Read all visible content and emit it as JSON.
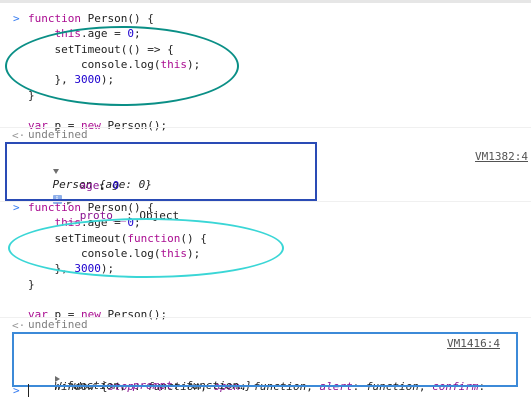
{
  "block1": {
    "code": [
      [
        {
          "t": "function",
          "c": "kw"
        },
        {
          "t": " Person() {",
          "c": "plain"
        }
      ],
      [
        {
          "t": "    this",
          "c": "kw"
        },
        {
          "t": ".age = ",
          "c": "plain"
        },
        {
          "t": "0",
          "c": "num"
        },
        {
          "t": ";",
          "c": "plain"
        }
      ],
      [
        {
          "t": "    setTimeout(() => {",
          "c": "plain"
        }
      ],
      [
        {
          "t": "        console.log(",
          "c": "plain"
        },
        {
          "t": "this",
          "c": "kw"
        },
        {
          "t": ");",
          "c": "plain"
        }
      ],
      [
        {
          "t": "    }, ",
          "c": "plain"
        },
        {
          "t": "3000",
          "c": "num"
        },
        {
          "t": ");",
          "c": "plain"
        }
      ],
      [
        {
          "t": "}",
          "c": "plain"
        }
      ],
      [
        {
          "t": "",
          "c": "plain"
        }
      ],
      [
        {
          "t": "var",
          "c": "kw"
        },
        {
          "t": " p = ",
          "c": "plain"
        },
        {
          "t": "new",
          "c": "kw"
        },
        {
          "t": " Person();",
          "c": "plain"
        }
      ]
    ],
    "result": "undefined"
  },
  "output1": {
    "object_name": "Person",
    "object_preview": " {age: 0}",
    "info": "i",
    "prop_key": "age",
    "prop_val": "0",
    "proto_key": "__proto__",
    "proto_val": ": Object",
    "source": "VM1382:4"
  },
  "block2": {
    "code": [
      [
        {
          "t": "function",
          "c": "kw"
        },
        {
          "t": " Person() {",
          "c": "plain"
        }
      ],
      [
        {
          "t": "    this",
          "c": "kw"
        },
        {
          "t": ".age = ",
          "c": "plain"
        },
        {
          "t": "0",
          "c": "num"
        },
        {
          "t": ";",
          "c": "plain"
        }
      ],
      [
        {
          "t": "    setTimeout(",
          "c": "plain"
        },
        {
          "t": "function",
          "c": "kw"
        },
        {
          "t": "() {",
          "c": "plain"
        }
      ],
      [
        {
          "t": "        console.log(",
          "c": "plain"
        },
        {
          "t": "this",
          "c": "kw"
        },
        {
          "t": ");",
          "c": "plain"
        }
      ],
      [
        {
          "t": "    }, ",
          "c": "plain"
        },
        {
          "t": "3000",
          "c": "num"
        },
        {
          "t": ");",
          "c": "plain"
        }
      ],
      [
        {
          "t": "}",
          "c": "plain"
        }
      ],
      [
        {
          "t": "",
          "c": "plain"
        }
      ],
      [
        {
          "t": "var",
          "c": "kw"
        },
        {
          "t": " p = ",
          "c": "plain"
        },
        {
          "t": "new",
          "c": "kw"
        },
        {
          "t": " Person();",
          "c": "plain"
        }
      ]
    ],
    "result": "undefined"
  },
  "output2": {
    "source": "VM1416:4",
    "object_name": "Window",
    "line1_props": [
      {
        "k": "stop",
        "v": "function"
      },
      {
        "k": "open",
        "v": "function"
      },
      {
        "k": "alert",
        "v": "function"
      },
      {
        "k": "confirm",
        "v": ""
      }
    ],
    "line2_text_start": "function",
    "line2_props": [
      {
        "k": "prompt",
        "v": "function…}"
      }
    ]
  },
  "prompt_symbol": ">",
  "result_symbol": "<·",
  "colors": {
    "teal_ellipse": "#0a8f86",
    "cyan_ellipse": "#3ad6d6",
    "navy_box": "#2a4bb5",
    "blue_box": "#3c8ad8",
    "keyword": "#aa0d91",
    "number": "#1c00cf"
  }
}
